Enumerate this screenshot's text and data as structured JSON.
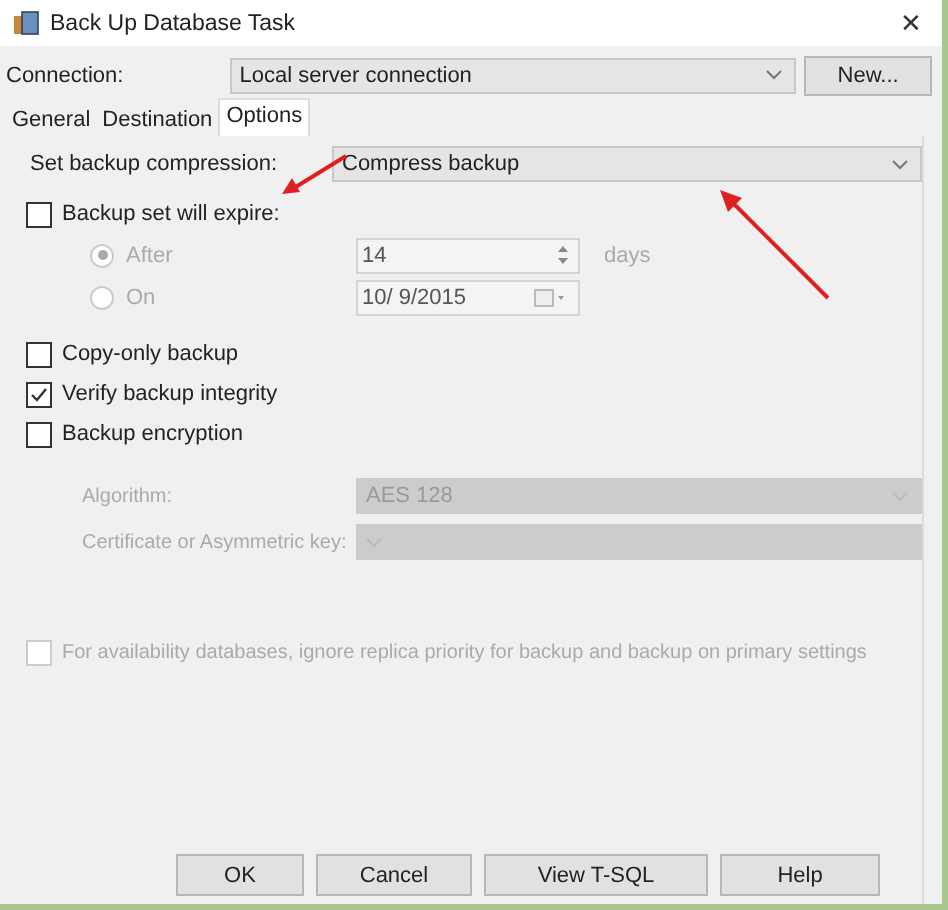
{
  "window": {
    "title": "Back Up Database Task",
    "close": "✕"
  },
  "connection": {
    "label": "Connection:",
    "value": "Local server connection",
    "new_button": "New..."
  },
  "tabs": [
    {
      "label": "General",
      "selected": false
    },
    {
      "label": "Destination",
      "selected": false
    },
    {
      "label": "Options",
      "selected": true
    }
  ],
  "compression": {
    "label": "Set backup compression:",
    "value": "Compress backup"
  },
  "expire": {
    "label": "Backup set will expire:",
    "checked": false,
    "options": [
      {
        "label": "After",
        "selected": true,
        "disabled": true,
        "value": "14",
        "unit": "days",
        "kind": "spin"
      },
      {
        "label": "On",
        "selected": false,
        "disabled": true,
        "value": "10/  9/2015",
        "kind": "date"
      }
    ]
  },
  "checks": [
    {
      "label": "Copy-only backup",
      "checked": false,
      "disabled": false
    },
    {
      "label": "Verify backup integrity",
      "checked": true,
      "disabled": false
    },
    {
      "label": "Backup encryption",
      "checked": false,
      "disabled": false
    }
  ],
  "encryption": [
    {
      "label": "Algorithm:",
      "value": "AES 128",
      "disabled": true
    },
    {
      "label": "Certificate or Asymmetric key:",
      "disabled": true
    }
  ],
  "availability": {
    "label": "For availability databases, ignore replica priority for backup and backup on primary settings",
    "checked": false,
    "disabled": true
  },
  "buttons": [
    "OK",
    "Cancel",
    "View T-SQL",
    "Help"
  ]
}
